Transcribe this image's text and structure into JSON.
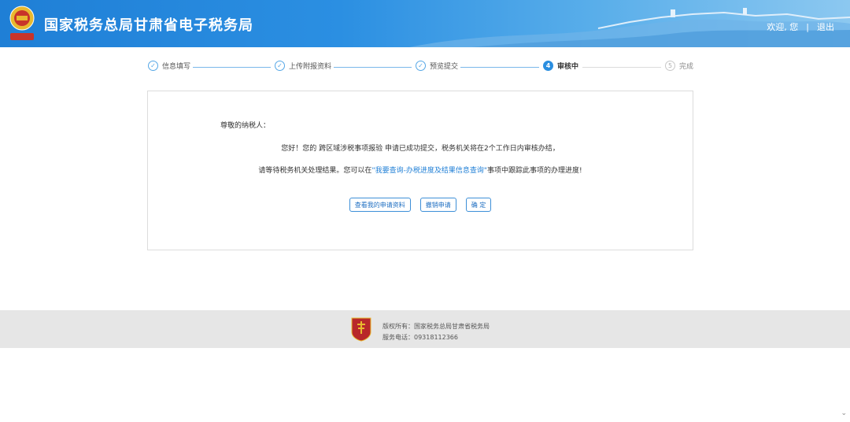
{
  "header": {
    "title": "国家税务总局甘肃省电子税务局",
    "logo_text": "中国税务",
    "welcome_label": "欢迎, 您",
    "separator": "|",
    "logout_label": "退出"
  },
  "steps": [
    {
      "num": "✓",
      "label": "信息填写",
      "state": "done"
    },
    {
      "num": "✓",
      "label": "上传附报资料",
      "state": "done"
    },
    {
      "num": "✓",
      "label": "预览提交",
      "state": "done"
    },
    {
      "num": "4",
      "label": "审核中",
      "state": "active"
    },
    {
      "num": "5",
      "label": "完成",
      "state": "pending"
    }
  ],
  "message": {
    "greeting": "尊敬的纳税人：",
    "line1": "您好！您的 跨区域涉税事项报验 申请已成功提交，税务机关将在2个工作日内审核办结，",
    "line2_prefix": "请等待税务机关处理结果。您可以在",
    "line2_link": "\"我要查询-办税进度及结果信息查询\"",
    "line2_suffix": "事项中跟踪此事项的办理进度!"
  },
  "buttons": {
    "view_label": "查看我的申请资料",
    "withdraw_label": "撤销申请",
    "confirm_label": "确 定"
  },
  "footer": {
    "copyright": "版权所有：国家税务总局甘肃省税务局",
    "phone": "服务电话：09318112366",
    "emblem_text": "中国税务"
  },
  "colors": {
    "accent": "#2a8ee0",
    "header_start": "#1f7fd6",
    "footer_bg": "#e6e6e6"
  }
}
